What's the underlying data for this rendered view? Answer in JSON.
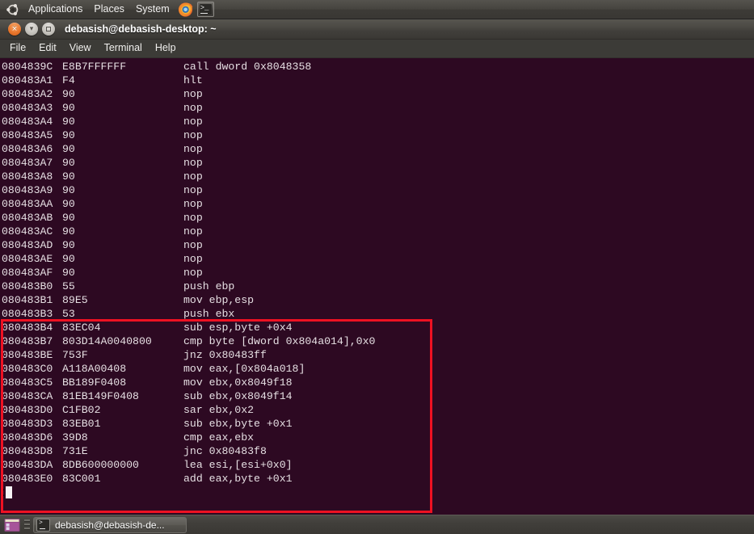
{
  "desktop": {
    "top_panel": {
      "logo_icon": "ubuntu-logo-icon",
      "menus": [
        {
          "label": "Applications"
        },
        {
          "label": "Places"
        },
        {
          "label": "System"
        }
      ],
      "launchers": [
        {
          "name": "firefox-launcher-icon",
          "title": "Firefox Web Browser"
        },
        {
          "name": "terminal-launcher-icon",
          "title": "Terminal",
          "glyph": ">_"
        }
      ]
    },
    "taskbar": {
      "show_desktop_icon": "show-desktop-icon",
      "grip_handle": "window-list-grip",
      "windows": [
        {
          "icon": "terminal-icon",
          "label": "debasish@debasish-de..."
        }
      ]
    }
  },
  "window": {
    "title": "debasish@debasish-desktop: ~",
    "controls": {
      "close": "×",
      "minimize": "▾",
      "maximize": "□"
    },
    "menubar": [
      {
        "label": "File"
      },
      {
        "label": "Edit"
      },
      {
        "label": "View"
      },
      {
        "label": "Terminal"
      },
      {
        "label": "Help"
      }
    ]
  },
  "terminal": {
    "background_color": "#2d0922",
    "foreground_color": "#e6dfe3",
    "prompt": ":",
    "cursor": "block",
    "lines": [
      {
        "address": "0804839C",
        "bytes": "E8B7FFFFFF",
        "mnemonic": "call dword 0x8048358"
      },
      {
        "address": "080483A1",
        "bytes": "F4",
        "mnemonic": "hlt"
      },
      {
        "address": "080483A2",
        "bytes": "90",
        "mnemonic": "nop"
      },
      {
        "address": "080483A3",
        "bytes": "90",
        "mnemonic": "nop"
      },
      {
        "address": "080483A4",
        "bytes": "90",
        "mnemonic": "nop"
      },
      {
        "address": "080483A5",
        "bytes": "90",
        "mnemonic": "nop"
      },
      {
        "address": "080483A6",
        "bytes": "90",
        "mnemonic": "nop"
      },
      {
        "address": "080483A7",
        "bytes": "90",
        "mnemonic": "nop"
      },
      {
        "address": "080483A8",
        "bytes": "90",
        "mnemonic": "nop"
      },
      {
        "address": "080483A9",
        "bytes": "90",
        "mnemonic": "nop"
      },
      {
        "address": "080483AA",
        "bytes": "90",
        "mnemonic": "nop"
      },
      {
        "address": "080483AB",
        "bytes": "90",
        "mnemonic": "nop"
      },
      {
        "address": "080483AC",
        "bytes": "90",
        "mnemonic": "nop"
      },
      {
        "address": "080483AD",
        "bytes": "90",
        "mnemonic": "nop"
      },
      {
        "address": "080483AE",
        "bytes": "90",
        "mnemonic": "nop"
      },
      {
        "address": "080483AF",
        "bytes": "90",
        "mnemonic": "nop"
      },
      {
        "address": "080483B0",
        "bytes": "55",
        "mnemonic": "push ebp"
      },
      {
        "address": "080483B1",
        "bytes": "89E5",
        "mnemonic": "mov ebp,esp"
      },
      {
        "address": "080483B3",
        "bytes": "53",
        "mnemonic": "push ebx"
      },
      {
        "address": "080483B4",
        "bytes": "83EC04",
        "mnemonic": "sub esp,byte +0x4"
      },
      {
        "address": "080483B7",
        "bytes": "803D14A0040800",
        "mnemonic": "cmp byte [dword 0x804a014],0x0"
      },
      {
        "address": "080483BE",
        "bytes": "753F",
        "mnemonic": "jnz 0x80483ff"
      },
      {
        "address": "080483C0",
        "bytes": "A118A00408",
        "mnemonic": "mov eax,[0x804a018]"
      },
      {
        "address": "080483C5",
        "bytes": "BB189F0408",
        "mnemonic": "mov ebx,0x8049f18"
      },
      {
        "address": "080483CA",
        "bytes": "81EB149F0408",
        "mnemonic": "sub ebx,0x8049f14"
      },
      {
        "address": "080483D0",
        "bytes": "C1FB02",
        "mnemonic": "sar ebx,0x2"
      },
      {
        "address": "080483D3",
        "bytes": "83EB01",
        "mnemonic": "sub ebx,byte +0x1"
      },
      {
        "address": "080483D6",
        "bytes": "39D8",
        "mnemonic": "cmp eax,ebx"
      },
      {
        "address": "080483D8",
        "bytes": "731E",
        "mnemonic": "jnc 0x80483f8"
      },
      {
        "address": "080483DA",
        "bytes": "8DB600000000",
        "mnemonic": "lea esi,[esi+0x0]"
      },
      {
        "address": "080483E0",
        "bytes": "83C001",
        "mnemonic": "add eax,byte +0x1"
      }
    ]
  },
  "annotation": {
    "highlight_color": "#ee1122",
    "starts_at_line_address": "080483B4",
    "ends_at_line_address": "080483E0"
  }
}
